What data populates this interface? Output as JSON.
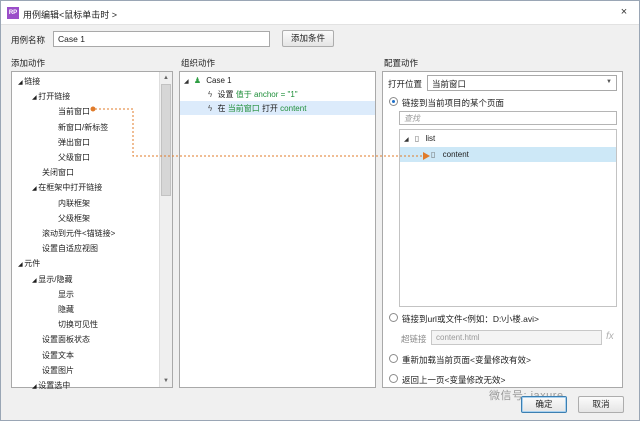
{
  "title_bar": {
    "app_icon": "RP",
    "title": "用例编辑<鼠标单击时 >",
    "close": "×"
  },
  "case_name": {
    "label": "用例名称",
    "value": "Case 1",
    "add_condition": "添加条件"
  },
  "headers": {
    "add_action": "添加动作",
    "organize_action": "组织动作",
    "configure_action": "配置动作"
  },
  "add_action_tree": [
    {
      "label": "链接",
      "level": 0,
      "expanded": true
    },
    {
      "label": "打开链接",
      "level": 1,
      "expanded": true
    },
    {
      "label": "当前窗口",
      "level": 2
    },
    {
      "label": "新窗口/新标签",
      "level": 2
    },
    {
      "label": "弹出窗口",
      "level": 2
    },
    {
      "label": "父级窗口",
      "level": 2
    },
    {
      "label": "关闭窗口",
      "level": 1
    },
    {
      "label": "在框架中打开链接",
      "level": 1,
      "expanded": true
    },
    {
      "label": "内联框架",
      "level": 2
    },
    {
      "label": "父级框架",
      "level": 2
    },
    {
      "label": "滚动到元件<锚链接>",
      "level": 1
    },
    {
      "label": "设置自适应视图",
      "level": 1
    },
    {
      "label": "元件",
      "level": 0,
      "expanded": true
    },
    {
      "label": "显示/隐藏",
      "level": 1,
      "expanded": true
    },
    {
      "label": "显示",
      "level": 2
    },
    {
      "label": "隐藏",
      "level": 2
    },
    {
      "label": "切换可见性",
      "level": 2
    },
    {
      "label": "设置面板状态",
      "level": 1
    },
    {
      "label": "设置文本",
      "level": 1
    },
    {
      "label": "设置图片",
      "level": 1
    },
    {
      "label": "设置选中",
      "level": 1,
      "expanded": true
    }
  ],
  "organize": {
    "case_label": "Case 1",
    "action1": {
      "prefix": "设置",
      "target": "值于",
      "value": "anchor = \"1\""
    },
    "action2": {
      "prefix": "在",
      "target": "当前窗口",
      "verb": "打开",
      "page": "content"
    }
  },
  "configure": {
    "open_in_label": "打开位置",
    "open_in_value": "当前窗口",
    "link_page_option": "链接到当前项目的某个页面",
    "search_placeholder": "查找",
    "page_tree": [
      {
        "label": "list"
      },
      {
        "label": "content"
      }
    ],
    "url_option": "链接到url或文件<例如：D:\\小楼.avi>",
    "hyperlink_label": "超链接",
    "hyperlink_value": "content.html",
    "fx": "fx",
    "reload_option": "重新加载当前页面<变量修改有效>",
    "back_option": "返回上一页<变量修改无效>"
  },
  "footer": {
    "ok": "确定",
    "cancel": "取消",
    "watermark": "微信号: iaxure"
  },
  "colors": {
    "selection": "#dcebfb",
    "selected_row": "#cde8f7",
    "connector": "#e07b2a",
    "link_blue": "#1e6fc8",
    "link_green": "#1f8f3a"
  }
}
